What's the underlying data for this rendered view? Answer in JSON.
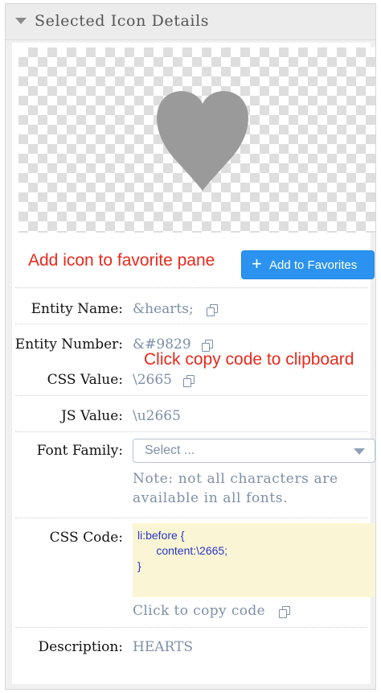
{
  "panel": {
    "title": "Selected Icon Details"
  },
  "preview": {
    "icon": "heart-icon",
    "icon_color": "#9a9a9a"
  },
  "annotations": {
    "favorite_hint": "Add icon to favorite pane",
    "copy_hint": "Click copy code to clipboard"
  },
  "favorites_button": {
    "icon": "plus-icon",
    "label": "Add to Favorites"
  },
  "details": {
    "entity_name_label": "Entity Name:",
    "entity_name_value": "&hearts;",
    "entity_number_label": "Entity Number:",
    "entity_number_value": "&#9829",
    "css_value_label": "CSS Value:",
    "css_value_value": "\\2665",
    "js_value_label": "JS Value:",
    "js_value_value": "\\u2665",
    "font_family_label": "Font Family:",
    "font_family_placeholder": "Select ...",
    "font_note": "Note: not all characters are available in all fonts.",
    "css_code_label": "CSS Code:",
    "css_code": "li:before {\n      content:\\2665;\n}",
    "copy_code_text": "Click to copy code",
    "description_label": "Description:",
    "description_value": "HEARTS"
  },
  "colors": {
    "accent": "#2b93ef",
    "annotation": "#e8291c",
    "value_text": "#7e8fa8",
    "code_background": "#faf6d5",
    "code_text": "#2a35c9"
  }
}
